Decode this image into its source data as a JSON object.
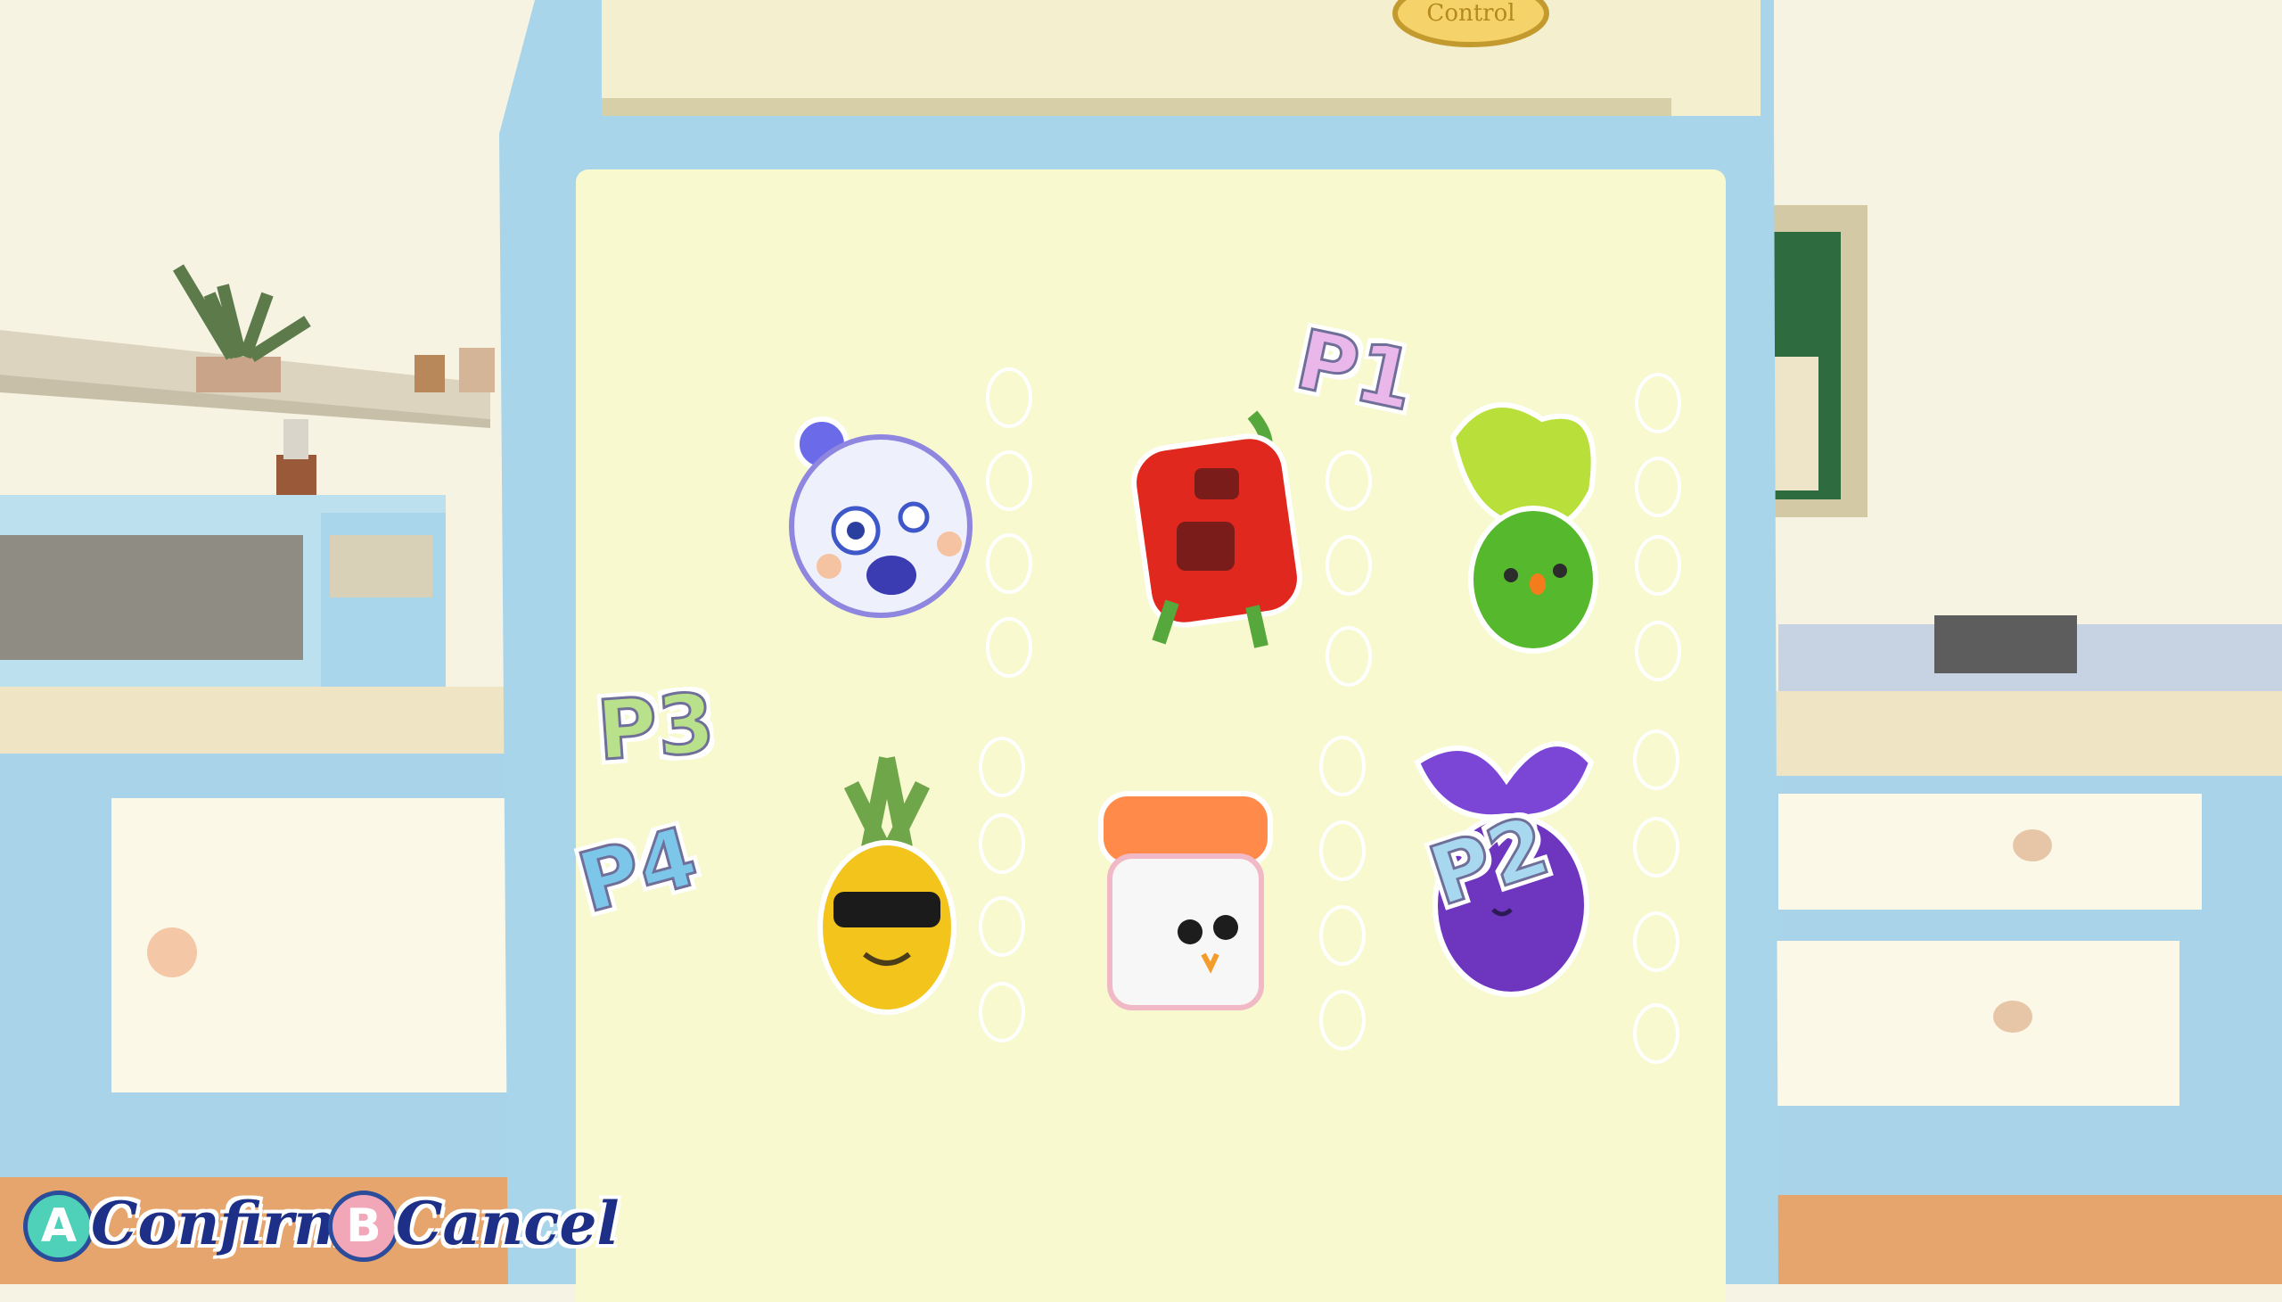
{
  "scene": {
    "badge_text": "Control"
  },
  "players": {
    "p1": "P1",
    "p2": "P2",
    "p3": "P3",
    "p4": "P4"
  },
  "characters": [
    {
      "name": "ghost-egg",
      "color": "#b7a8ef"
    },
    {
      "name": "tomato-cube",
      "color": "#e8312b"
    },
    {
      "name": "bok-choy",
      "color": "#8dcf3a"
    },
    {
      "name": "pineapple",
      "color": "#f0c21b"
    },
    {
      "name": "salmon-sushi",
      "color": "#ff8a4a"
    },
    {
      "name": "eggplant",
      "color": "#6c37c7"
    }
  ],
  "controls": {
    "confirm_button": "A",
    "confirm_label": "Confirm",
    "cancel_button": "B",
    "cancel_label": "Cancel"
  }
}
